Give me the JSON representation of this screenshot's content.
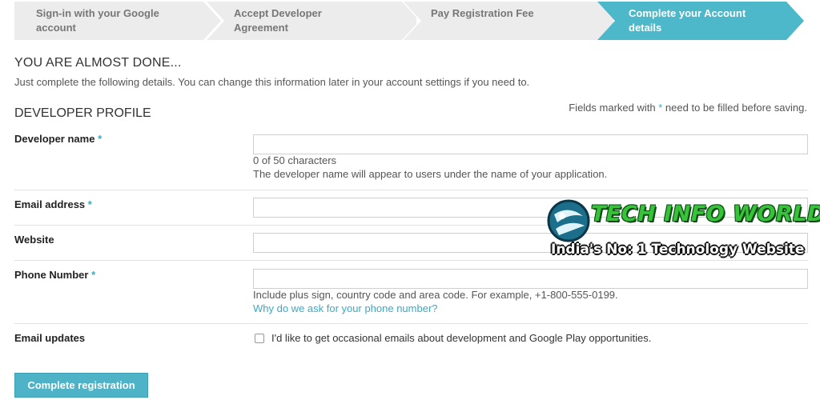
{
  "steps": [
    {
      "label": "Sign-in with your Google account",
      "active": false
    },
    {
      "label": "Accept Developer Agreement",
      "active": false
    },
    {
      "label": "Pay Registration Fee",
      "active": false
    },
    {
      "label": "Complete your Account details",
      "active": true
    }
  ],
  "header": {
    "title": "YOU ARE ALMOST DONE...",
    "subtitle": "Just complete the following details. You can change this information later in your account settings if you need to."
  },
  "profile": {
    "section_title": "DEVELOPER PROFILE",
    "required_note_prefix": "Fields marked with",
    "required_star": "*",
    "required_note_suffix": "need to be filled before saving."
  },
  "fields": {
    "developer_name": {
      "label": "Developer name",
      "value": "",
      "counter": "0 of 50 characters",
      "hint": "The developer name will appear to users under the name of your application."
    },
    "email": {
      "label": "Email address",
      "value": ""
    },
    "website": {
      "label": "Website",
      "value": ""
    },
    "phone": {
      "label": "Phone Number",
      "value": "",
      "hint": "Include plus sign, country code and area code. For example, +1-800-555-0199.",
      "link": "Why do we ask for your phone number?"
    },
    "email_updates": {
      "label": "Email updates",
      "checkbox_label": "I'd like to get occasional emails about development and Google Play opportunities.",
      "checked": false
    }
  },
  "submit_label": "Complete registration",
  "watermark": {
    "title": "TECH INFO WORLD",
    "tagline": "India's No: 1 Technology Website"
  },
  "colors": {
    "accent": "#4fb3c8",
    "step_inactive": "#ececec",
    "step_active": "#4cb8ca",
    "link": "#3aa9c4"
  }
}
